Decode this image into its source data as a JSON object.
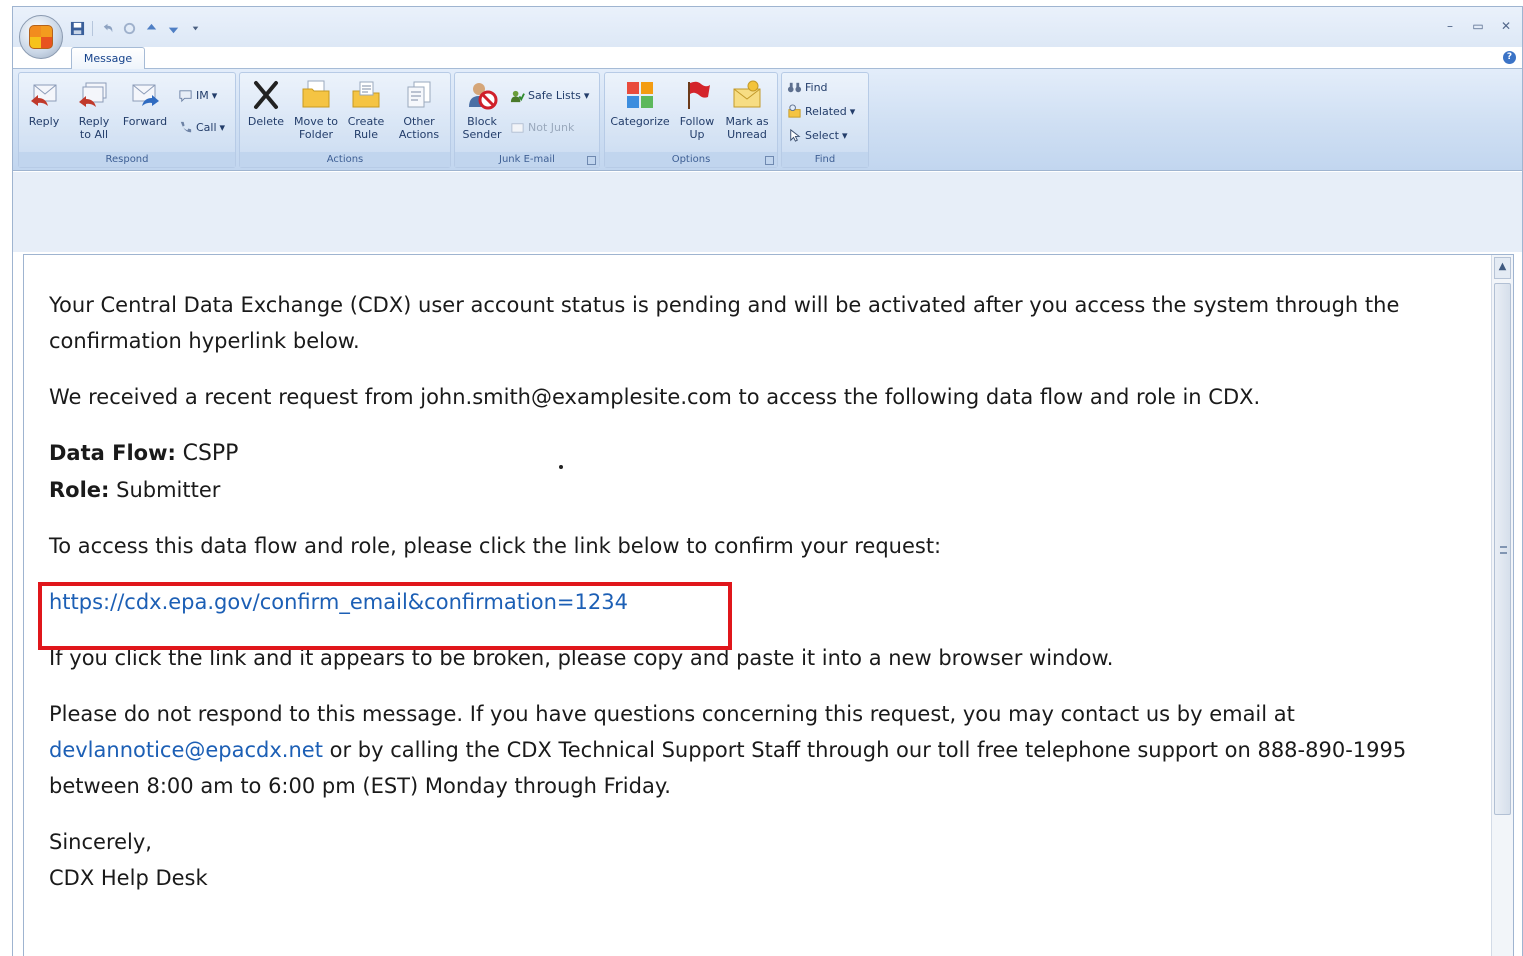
{
  "ribbon": {
    "active_tab": "Message",
    "groups": {
      "respond": {
        "label": "Respond",
        "reply": "Reply",
        "reply_all": "Reply\nto All",
        "forward": "Forward",
        "im": "IM",
        "call": "Call"
      },
      "actions": {
        "label": "Actions",
        "delete": "Delete",
        "move_to_folder": "Move to\nFolder",
        "create_rule": "Create\nRule",
        "other_actions": "Other\nActions"
      },
      "junk": {
        "label": "Junk E-mail",
        "block_sender": "Block\nSender",
        "safe_lists": "Safe Lists",
        "not_junk": "Not Junk"
      },
      "options": {
        "label": "Options",
        "categorize": "Categorize",
        "follow_up": "Follow\nUp",
        "mark_unread": "Mark as\nUnread"
      },
      "find": {
        "label": "Find",
        "find": "Find",
        "related": "Related",
        "select": "Select"
      }
    }
  },
  "message": {
    "para1": "Your Central Data Exchange (CDX) user account status is pending and will be activated after you access the system through the confirmation hyperlink below.",
    "para2": "We received a recent request from john.smith@examplesite.com to access the following data flow and role in CDX.",
    "data_flow_label": "Data Flow:",
    "data_flow_value": "CSPP",
    "role_label": "Role:",
    "role_value": "Submitter",
    "para3": "To access this data flow and role, please click the link below to confirm your request:",
    "confirm_link": "https://cdx.epa.gov/confirm_email&confirmation=1234",
    "para4": "If you click the link and it appears to be broken, please copy and paste it into a new browser window.",
    "para5_a": "Please do not respond to this message. If you have questions concerning this request, you may contact us by email at",
    "support_email": "devlannotice@epacdx.net",
    "para5_b": "or by calling the CDX Technical Support Staff through our toll free telephone support on 888-890-1995 between 8:00 am to 6:00 pm (EST) Monday through Friday.",
    "closing": "Sincerely,",
    "signature": "CDX Help Desk"
  },
  "colors": {
    "highlight": "#e0161b",
    "link": "#1c5fb5"
  }
}
